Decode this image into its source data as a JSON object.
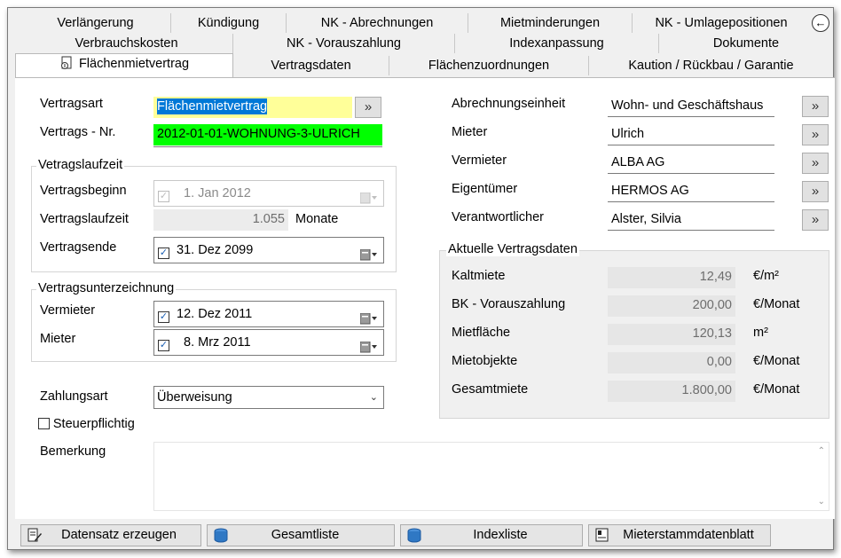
{
  "tabs": {
    "row1": [
      "Verlängerung",
      "Kündigung",
      "NK - Abrechnungen",
      "Mietminderungen",
      "NK - Umlagepositionen"
    ],
    "row2": [
      "Verbrauchskosten",
      "NK - Vorauszahlung",
      "Indexanpassung",
      "Dokumente"
    ],
    "row3": [
      "Flächenmietvertrag",
      "Vertragsdaten",
      "Flächenzuordnungen",
      "Kaution / Rückbau / Garantie"
    ],
    "back_icon": "circle-left-arrow-icon"
  },
  "left": {
    "vertragsart_label": "Vertragsart",
    "vertragsart_value": "Flächenmietvertrag",
    "vertragsnr_label": "Vertrags - Nr.",
    "vertragsnr_value": "2012-01-01-WOHNUNG-3-ULRICH",
    "laufzeit_group": "Vetragslaufzeit",
    "beginn_label": "Vertragsbeginn",
    "beginn_value": "1. Jan 2012",
    "laufzeit_label": "Vertragslaufzeit",
    "laufzeit_value": "1.055",
    "laufzeit_unit": "Monate",
    "ende_label": "Vertragsende",
    "ende_value": "31. Dez 2099",
    "unterz_group": "Vertragsunterzeichnung",
    "vermieter_label": "Vermieter",
    "vermieter_value": "12. Dez 2011",
    "mieter_label": "Mieter",
    "mieter_value": "8. Mrz 2011",
    "zahlungsart_label": "Zahlungsart",
    "zahlungsart_value": "Überweisung",
    "steuer_label": "Steuerpflichtig",
    "bemerkung_label": "Bemerkung",
    "lookup_glyph": "»",
    "check_glyph": "✓"
  },
  "right": {
    "rows": [
      {
        "label": "Abrechnungseinheit",
        "value": "Wohn- und Geschäftshaus"
      },
      {
        "label": "Mieter",
        "value": "Ulrich"
      },
      {
        "label": "Vermieter",
        "value": "ALBA AG"
      },
      {
        "label": "Eigentümer",
        "value": "HERMOS AG"
      },
      {
        "label": "Verantwortlicher",
        "value": "Alster, Silvia"
      }
    ],
    "aktuell_group": "Aktuelle Vertragsdaten",
    "aktuell": [
      {
        "label": "Kaltmiete",
        "value": "12,49",
        "unit": "€/m²"
      },
      {
        "label": "BK - Vorauszahlung",
        "value": "200,00",
        "unit": "€/Monat"
      },
      {
        "label": "Mietfläche",
        "value": "120,13",
        "unit": "m²"
      },
      {
        "label": "Mietobjekte",
        "value": "0,00",
        "unit": "€/Monat"
      },
      {
        "label": "Gesamtmiete",
        "value": "1.800,00",
        "unit": "€/Monat"
      }
    ]
  },
  "footer": {
    "buttons": [
      "Datensatz erzeugen",
      "Gesamtliste",
      "Indexliste",
      "Mieterstammdatenblatt"
    ]
  }
}
